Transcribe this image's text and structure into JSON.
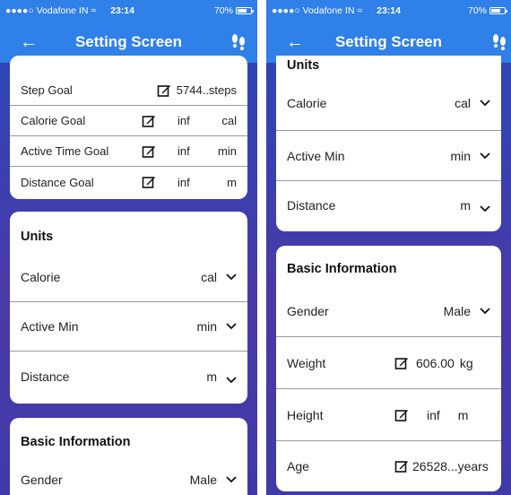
{
  "left": {
    "status": {
      "carrier": "●●●●○ Vodafone IN ≈",
      "time": "23:14",
      "battery": "70%"
    },
    "nav": {
      "back": "←",
      "title": "Setting Screen"
    },
    "goals": [
      {
        "label": "Step Goal",
        "value": "5744..steps",
        "unit": ""
      },
      {
        "label": "Calorie Goal",
        "value": "inf",
        "unit": "cal"
      },
      {
        "label": "Active Time Goal",
        "value": "inf",
        "unit": "min"
      },
      {
        "label": "Distance Goal",
        "value": "inf",
        "unit": "m"
      }
    ],
    "units": {
      "title": "Units",
      "rows": [
        {
          "label": "Calorie",
          "value": "cal"
        },
        {
          "label": "Active Min",
          "value": "min"
        },
        {
          "label": "Distance",
          "value": "m"
        }
      ]
    },
    "basic": {
      "title": "Basic Information",
      "rows": [
        {
          "label": "Gender",
          "value": "Male"
        }
      ]
    }
  },
  "right": {
    "status": {
      "carrier": "●●●●○ Vodafone IN ≈",
      "time": "23:14",
      "battery": "70%"
    },
    "nav": {
      "back": "←",
      "title": "Setting Screen"
    },
    "units": {
      "title": "Units",
      "rows": [
        {
          "label": "Calorie",
          "value": "cal"
        },
        {
          "label": "Active Min",
          "value": "min"
        },
        {
          "label": "Distance",
          "value": "m"
        }
      ]
    },
    "basic": {
      "title": "Basic Information",
      "gender": {
        "label": "Gender",
        "value": "Male"
      },
      "weight": {
        "label": "Weight",
        "value": "606.00",
        "unit": "kg"
      },
      "height": {
        "label": "Height",
        "value": "inf",
        "unit": "m"
      },
      "age": {
        "label": "Age",
        "value": "26528...years"
      }
    }
  },
  "icons": {
    "edit": "edit-icon",
    "chevron": "chevron-down-icon",
    "steps": "footsteps-icon"
  }
}
